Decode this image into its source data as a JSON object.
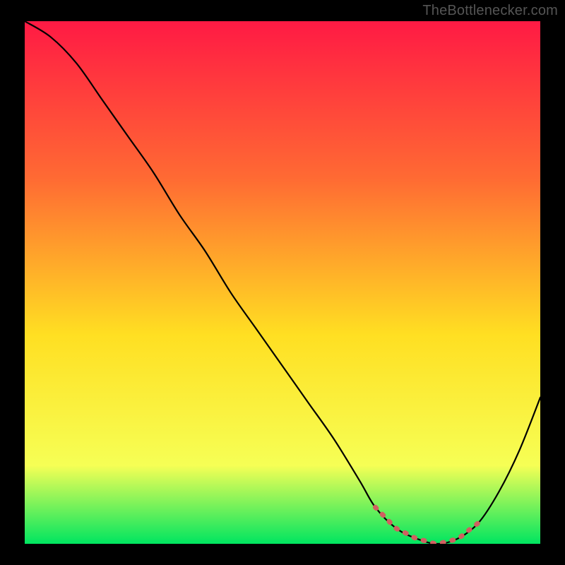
{
  "attribution": "TheBottlenecker.com",
  "chart_data": {
    "type": "line",
    "title": "",
    "xlabel": "",
    "ylabel": "",
    "xlim": [
      0,
      100
    ],
    "ylim": [
      0,
      100
    ],
    "series": [
      {
        "name": "bottleneck-curve",
        "x": [
          0,
          5,
          10,
          15,
          20,
          25,
          30,
          35,
          40,
          45,
          50,
          55,
          60,
          65,
          68,
          72,
          76,
          80,
          84,
          88,
          92,
          96,
          100
        ],
        "values": [
          100,
          97,
          92,
          85,
          78,
          71,
          63,
          56,
          48,
          41,
          34,
          27,
          20,
          12,
          7,
          3,
          1,
          0,
          1,
          4,
          10,
          18,
          28
        ]
      }
    ],
    "highlight": {
      "name": "optimal-band",
      "x": [
        68,
        70,
        72,
        74,
        76,
        78,
        80,
        82,
        84,
        86,
        88
      ],
      "values": [
        7,
        5,
        3,
        2,
        1,
        0.5,
        0,
        0.5,
        1,
        2.5,
        4
      ]
    },
    "background_gradient": {
      "top": "#ff1a44",
      "mid_top": "#ff6a33",
      "mid": "#ffdf22",
      "mid_bottom": "#f6ff55",
      "bottom": "#00e560"
    }
  }
}
